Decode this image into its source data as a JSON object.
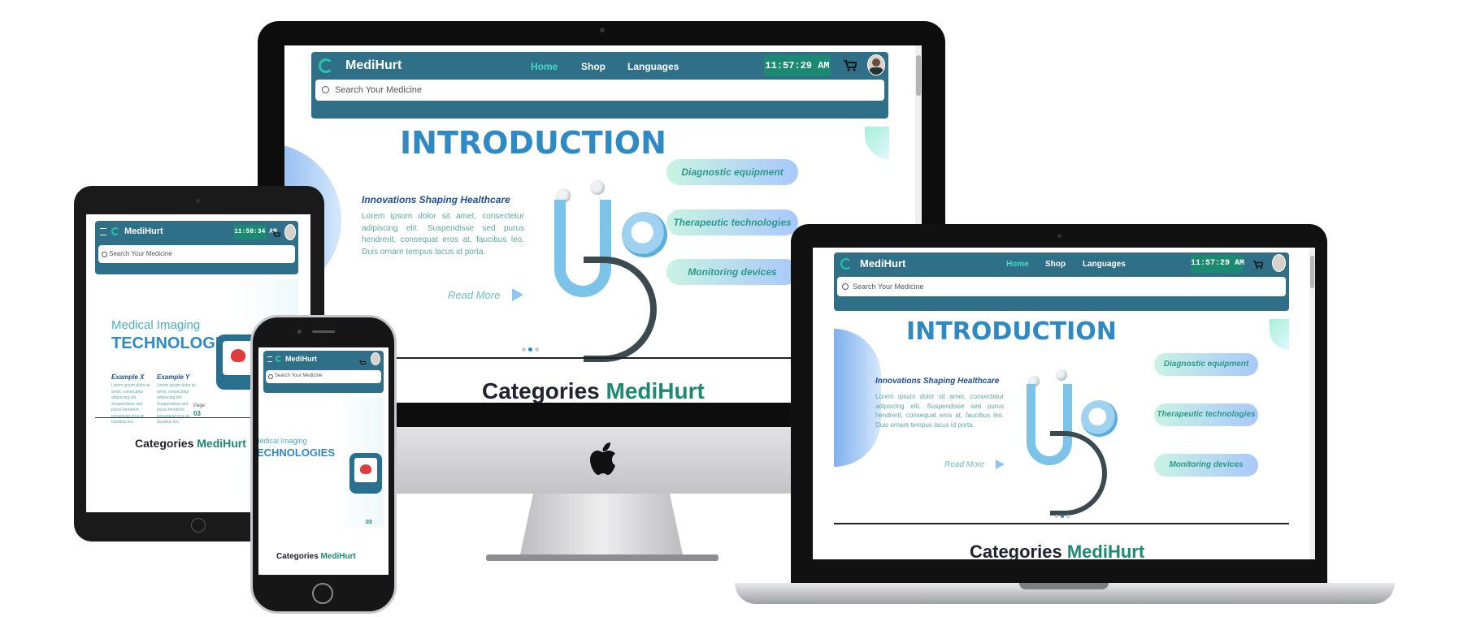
{
  "site": {
    "brand": "MediHurt",
    "nav": {
      "home": "Home",
      "shop": "Shop",
      "languages": "Languages"
    },
    "clock": "11:57:29 AM",
    "tablet_clock": "11:58:34 AM",
    "search_placeholder": "Search Your Medicine",
    "intro_title": "INTRODUCTION",
    "subtitle": "Innovations Shaping Healthcare",
    "paragraph": "Lorem ipsum dolor sit amet, consectetur adipiscing elit. Suspendisse sed purus hendrerit, consequat eros at, faucibus leo. Duis ornare tempus lacus id porta.",
    "read_more": "Read More",
    "pills": [
      "Diagnostic equipment",
      "Therapeutic technologies",
      "Monitoring devices"
    ],
    "categories": {
      "prefix": "Categories ",
      "accent": "MediHurt"
    },
    "slide2": {
      "title_light": "Medical Imaging",
      "title_bold": "TECHNOLOGIES",
      "col1_head": "Example X",
      "col2_head": "Example Y",
      "col_text": "Lorem ipsum dolor sit amet, consectetur adipiscing elit. Suspendisse sed purus hendrerit, consequat eros at, faucibus leo.",
      "page_label": "Page",
      "page_num": "03"
    }
  },
  "colors": {
    "nav": "#2f6f88",
    "accent": "#1c8a72",
    "title": "#2d8ac4"
  },
  "icons": [
    "apple-logo-icon",
    "cart-icon",
    "search-icon",
    "menu-icon",
    "arrow-right-icon",
    "logo-icon"
  ]
}
